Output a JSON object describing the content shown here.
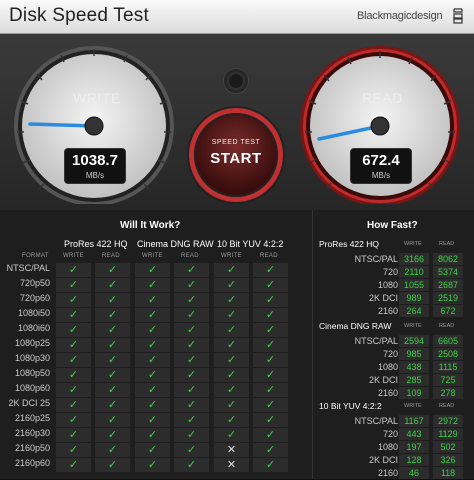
{
  "window": {
    "title": "Disk Speed Test",
    "brand": "Blackmagicdesign"
  },
  "gauges": {
    "write": {
      "label": "WRITE",
      "value": "1038.7",
      "unit": "MB/s",
      "accent": "#2a8be0"
    },
    "read": {
      "label": "READ",
      "value": "672.4",
      "unit": "MB/s",
      "accent": "#2a8be0"
    }
  },
  "start_button": {
    "line1": "SPEED TEST",
    "line2": "START",
    "ring_color": "#c03030"
  },
  "colors": {
    "check": "#3fd24a"
  },
  "will_it_work": {
    "title": "Will It Work?",
    "format_header": "FORMAT",
    "codecs": [
      "ProRes 422 HQ",
      "Cinema DNG RAW",
      "10 Bit YUV 4:2:2"
    ],
    "subheaders": [
      "WRITE",
      "READ"
    ],
    "rows": [
      {
        "format": "NTSC/PAL",
        "cells": [
          "✓",
          "✓",
          "✓",
          "✓",
          "✓",
          "✓"
        ]
      },
      {
        "format": "720p50",
        "cells": [
          "✓",
          "✓",
          "✓",
          "✓",
          "✓",
          "✓"
        ]
      },
      {
        "format": "720p60",
        "cells": [
          "✓",
          "✓",
          "✓",
          "✓",
          "✓",
          "✓"
        ]
      },
      {
        "format": "1080i50",
        "cells": [
          "✓",
          "✓",
          "✓",
          "✓",
          "✓",
          "✓"
        ]
      },
      {
        "format": "1080i60",
        "cells": [
          "✓",
          "✓",
          "✓",
          "✓",
          "✓",
          "✓"
        ]
      },
      {
        "format": "1080p25",
        "cells": [
          "✓",
          "✓",
          "✓",
          "✓",
          "✓",
          "✓"
        ]
      },
      {
        "format": "1080p30",
        "cells": [
          "✓",
          "✓",
          "✓",
          "✓",
          "✓",
          "✓"
        ]
      },
      {
        "format": "1080p50",
        "cells": [
          "✓",
          "✓",
          "✓",
          "✓",
          "✓",
          "✓"
        ]
      },
      {
        "format": "1080p60",
        "cells": [
          "✓",
          "✓",
          "✓",
          "✓",
          "✓",
          "✓"
        ]
      },
      {
        "format": "2K DCI 25",
        "cells": [
          "✓",
          "✓",
          "✓",
          "✓",
          "✓",
          "✓"
        ]
      },
      {
        "format": "2160p25",
        "cells": [
          "✓",
          "✓",
          "✓",
          "✓",
          "✓",
          "✓"
        ]
      },
      {
        "format": "2160p30",
        "cells": [
          "✓",
          "✓",
          "✓",
          "✓",
          "✓",
          "✓"
        ]
      },
      {
        "format": "2160p50",
        "cells": [
          "✓",
          "✓",
          "✓",
          "✓",
          "✕",
          "✓"
        ]
      },
      {
        "format": "2160p60",
        "cells": [
          "✓",
          "✓",
          "✓",
          "✓",
          "✕",
          "✓"
        ]
      }
    ]
  },
  "how_fast": {
    "title": "How Fast?",
    "subheaders": [
      "WRITE",
      "READ"
    ],
    "groups": [
      {
        "name": "ProRes 422 HQ",
        "rows": [
          {
            "label": "NTSC/PAL",
            "write": "3166",
            "read": "8062"
          },
          {
            "label": "720",
            "write": "2110",
            "read": "5374"
          },
          {
            "label": "1080",
            "write": "1055",
            "read": "2687"
          },
          {
            "label": "2K DCI",
            "write": "989",
            "read": "2519"
          },
          {
            "label": "2160",
            "write": "264",
            "read": "672"
          }
        ]
      },
      {
        "name": "Cinema DNG RAW",
        "rows": [
          {
            "label": "NTSC/PAL",
            "write": "2594",
            "read": "6605"
          },
          {
            "label": "720",
            "write": "985",
            "read": "2508"
          },
          {
            "label": "1080",
            "write": "438",
            "read": "1115"
          },
          {
            "label": "2K DCI",
            "write": "285",
            "read": "725"
          },
          {
            "label": "2160",
            "write": "109",
            "read": "278"
          }
        ]
      },
      {
        "name": "10 Bit YUV 4:2:2",
        "rows": [
          {
            "label": "NTSC/PAL",
            "write": "1167",
            "read": "2972"
          },
          {
            "label": "720",
            "write": "443",
            "read": "1129"
          },
          {
            "label": "1080",
            "write": "197",
            "read": "502"
          },
          {
            "label": "2K DCI",
            "write": "128",
            "read": "326"
          },
          {
            "label": "2160",
            "write": "46",
            "read": "118"
          }
        ]
      }
    ]
  }
}
